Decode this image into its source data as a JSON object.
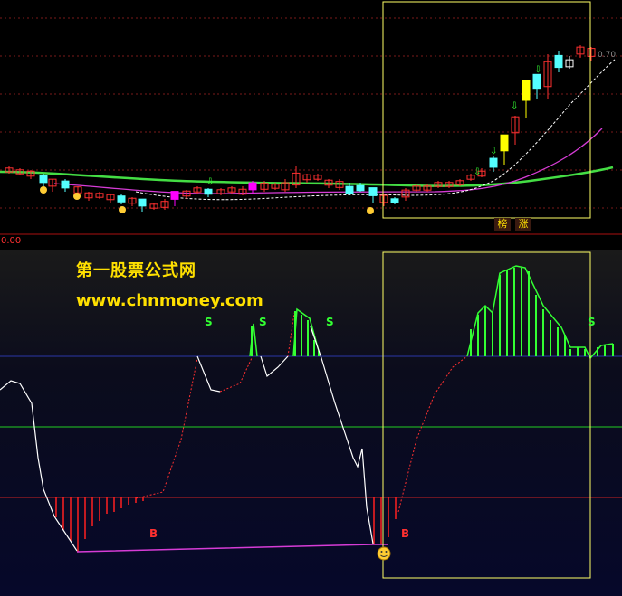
{
  "watermark": {
    "title": "第一股票公式网",
    "url": "www.chnmoney.com"
  },
  "top_panel": {
    "axis_value": "0.00",
    "corner_value": "0.70",
    "tags": [
      "榜",
      "涨"
    ]
  },
  "bottom_panel": {
    "sell_label": "S",
    "buy_label": "B"
  },
  "colors": {
    "background": "#000000",
    "up_candle": "#ff3030",
    "down_candle": "#54ffff",
    "highlight_candle_yellow": "#ffff00",
    "highlight_candle_magenta": "#ff00ff",
    "ma_green": "#44dd44",
    "ma_magenta": "#d63cd6",
    "ma_dashed": "#ffffff",
    "selection_box": "#ffff66",
    "signal_green": "#33ff33",
    "signal_red": "#ff2020",
    "level_blue": "#2a36a8",
    "level_green": "#22cc22",
    "level_red": "#cc2222"
  }
}
